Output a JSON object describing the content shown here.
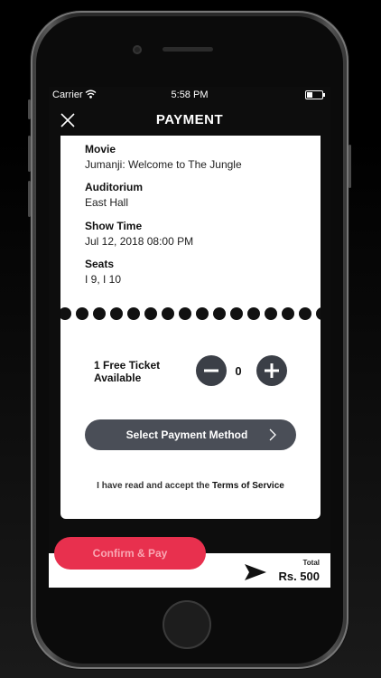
{
  "status_bar": {
    "carrier": "Carrier",
    "time": "5:58 PM"
  },
  "header": {
    "title": "PAYMENT",
    "close_icon": "close-icon"
  },
  "details": [
    {
      "label": "Movie",
      "value": "Jumanji: Welcome to The Jungle"
    },
    {
      "label": "Auditorium",
      "value": "East Hall"
    },
    {
      "label": "Show Time",
      "value": "Jul 12, 2018 08:00 PM"
    },
    {
      "label": "Seats",
      "value": "I 9, I 10"
    }
  ],
  "free_ticket": {
    "line1": "1 Free Ticket",
    "line2": "Available",
    "quantity": "0",
    "minus_icon": "minus-icon",
    "plus_icon": "plus-icon"
  },
  "payment": {
    "select_label": "Select Payment Method",
    "chevron_icon": "chevron-right-icon"
  },
  "terms": {
    "prefix": "I have read and accept the ",
    "link": "Terms of Service"
  },
  "footer": {
    "confirm_label": "Confirm & Pay",
    "total_label": "Total",
    "total_amount": "Rs. 500",
    "send_icon": "paper-plane-icon"
  },
  "colors": {
    "accent": "#e8304e",
    "button_dark": "#4a4e57",
    "stepper": "#3b3f47",
    "background": "#0d0d0d",
    "card": "#ffffff"
  }
}
